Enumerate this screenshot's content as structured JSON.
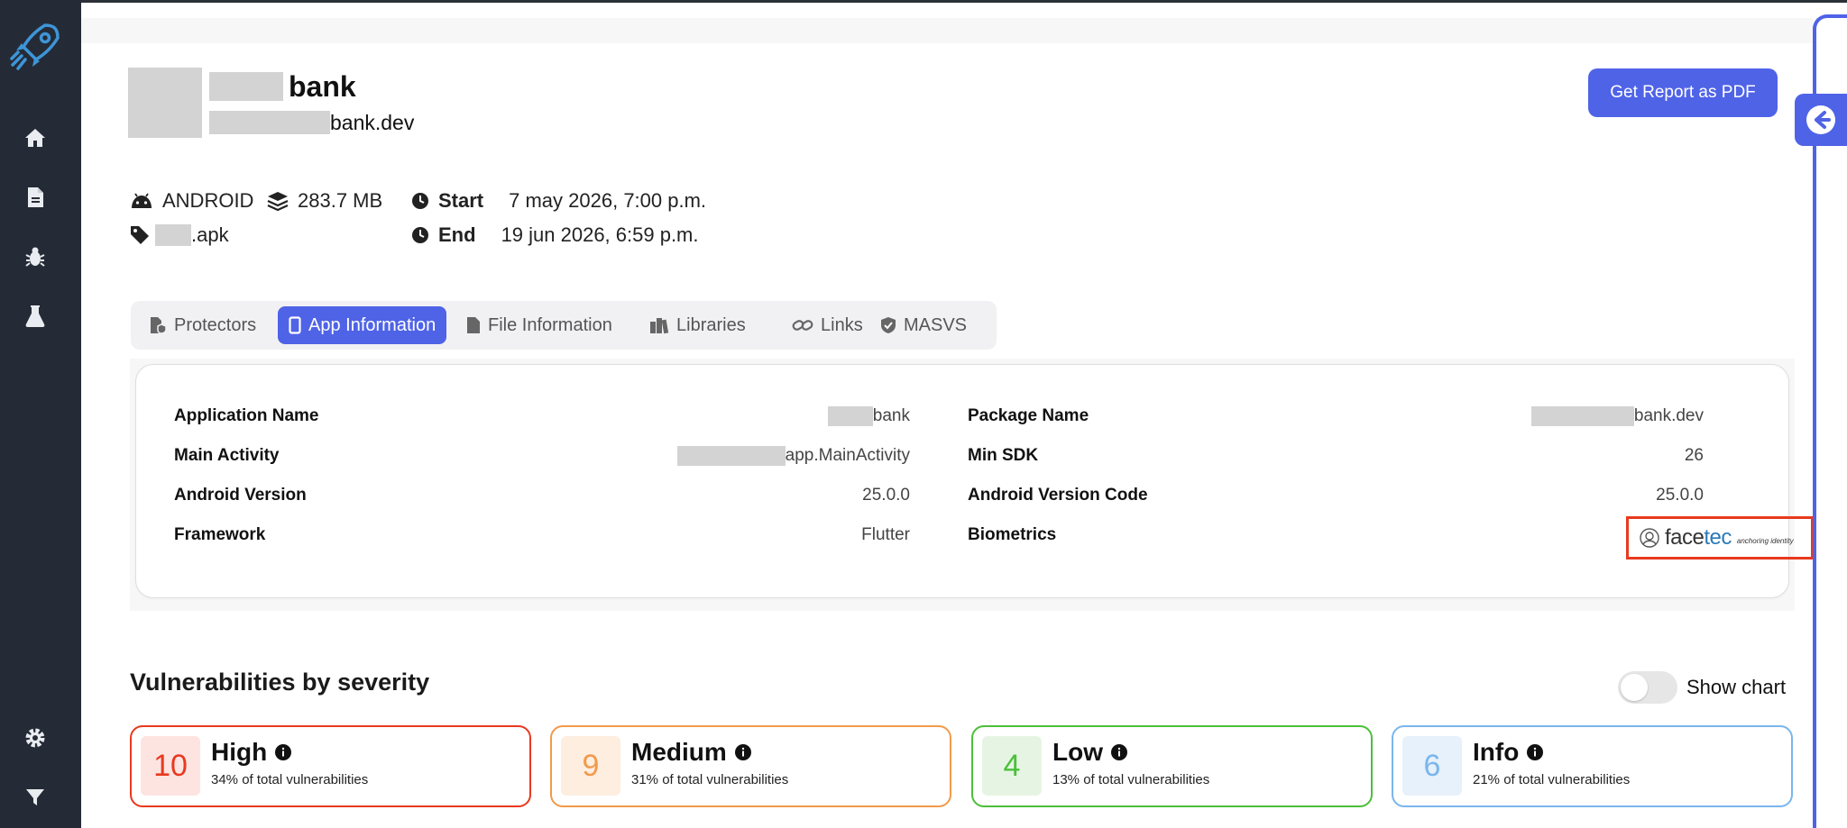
{
  "app": {
    "title_suffix": "bank",
    "domain_suffix": "bank.dev",
    "report_button": "Get Report as PDF"
  },
  "meta": {
    "platform": "ANDROID",
    "size": "283.7 MB",
    "file_suffix": ".apk",
    "start_label": "Start",
    "start_value": "7 may 2026, 7:00 p.m.",
    "end_label": "End",
    "end_value": "19 jun 2026, 6:59 p.m."
  },
  "tabs": [
    {
      "label": "Protectors",
      "icon": "shield-file-icon",
      "active": false
    },
    {
      "label": "App Information",
      "icon": "mobile-icon",
      "active": true
    },
    {
      "label": "File Information",
      "icon": "file-icon",
      "active": false
    },
    {
      "label": "Libraries",
      "icon": "books-icon",
      "active": false
    },
    {
      "label": "Links",
      "icon": "link-icon",
      "active": false
    },
    {
      "label": "MASVS",
      "icon": "shield-check-icon",
      "active": false
    }
  ],
  "app_info": {
    "left": [
      {
        "label": "Application Name",
        "value": "bank"
      },
      {
        "label": "Main Activity",
        "value": "app.MainActivity"
      },
      {
        "label": "Android Version",
        "value": "25.0.0"
      },
      {
        "label": "Framework",
        "value": "Flutter"
      }
    ],
    "right": [
      {
        "label": "Package Name",
        "value": "bank.dev"
      },
      {
        "label": "Min SDK",
        "value": "26"
      },
      {
        "label": "Android Version Code",
        "value": "25.0.0"
      },
      {
        "label": "Biometrics",
        "value": ""
      }
    ],
    "biometrics_logo": {
      "brand_a": "face",
      "brand_b": "tec",
      "tagline": "anchoring identity"
    }
  },
  "severity": {
    "title": "Vulnerabilities by severity",
    "toggle_label": "Show chart",
    "toggle_on": false,
    "cards": [
      {
        "count": "10",
        "name": "High",
        "desc": "34% of total vulnerabilities",
        "color": "#e8391f",
        "bg": "#fde4e1"
      },
      {
        "count": "9",
        "name": "Medium",
        "desc": "31% of total vulnerabilities",
        "color": "#f29a4a",
        "bg": "#fdeee0"
      },
      {
        "count": "4",
        "name": "Low",
        "desc": "13% of total vulnerabilities",
        "color": "#4cbf3a",
        "bg": "#e6f5e3"
      },
      {
        "count": "6",
        "name": "Info",
        "desc": "21% of total vulnerabilities",
        "color": "#7ab6ec",
        "bg": "#e6f1fb"
      }
    ]
  },
  "colors": {
    "accent": "#4f63e7",
    "sidebar": "#252b36",
    "highlight_border": "#e8391f"
  }
}
